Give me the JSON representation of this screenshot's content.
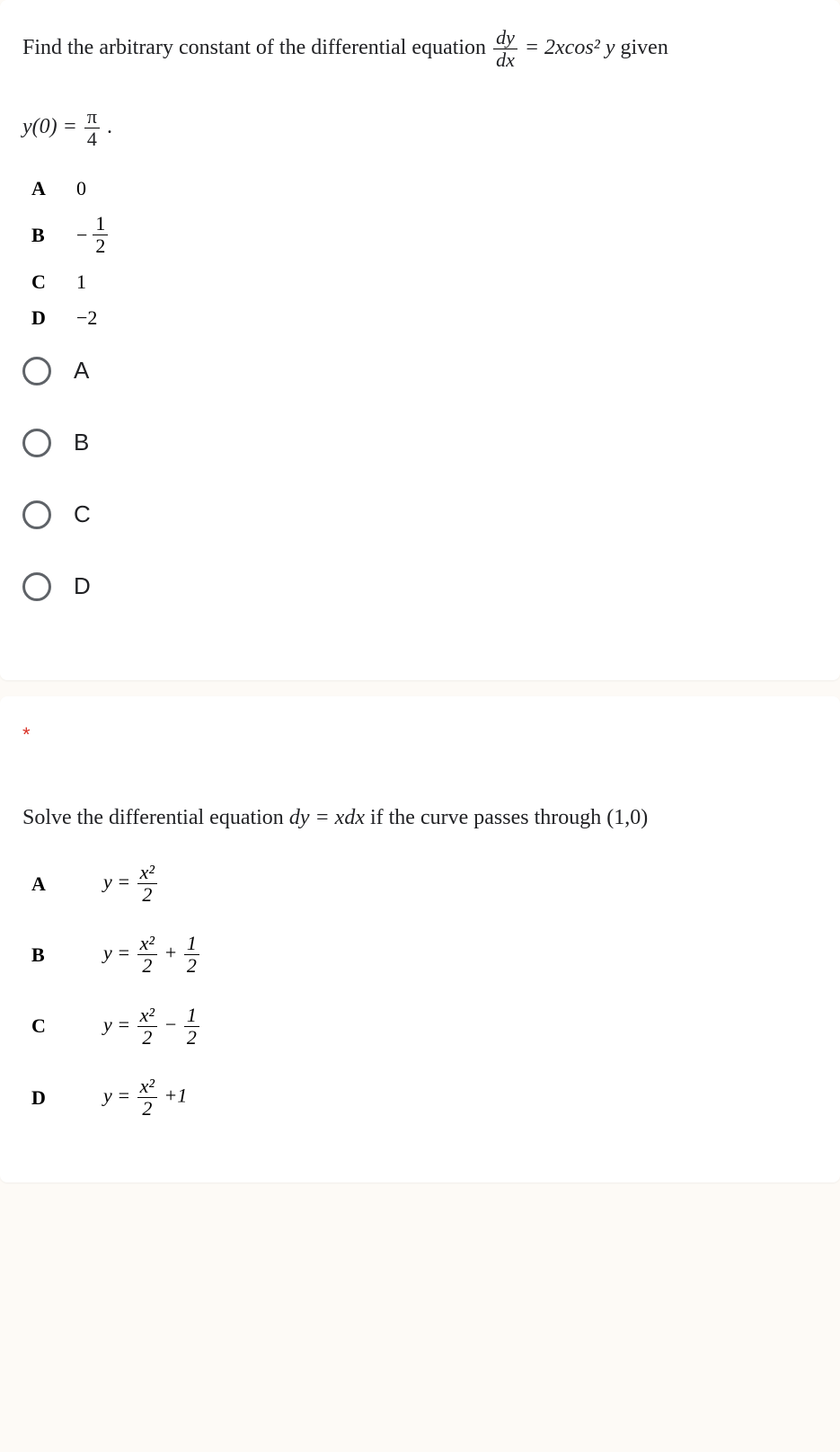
{
  "question1": {
    "prompt_part1": "Find the arbitrary constant of the differential equation ",
    "prompt_part2": " given",
    "equation_lhs_num": "dy",
    "equation_lhs_den": "dx",
    "equation_rhs": "= 2xcos² y",
    "initial_cond_left": "y(0) = ",
    "initial_cond_num": "π",
    "initial_cond_den": "4",
    "initial_cond_dot": ".",
    "answerKey": {
      "A": {
        "letter": "A",
        "text": "0"
      },
      "B": {
        "letter": "B",
        "num": "1",
        "den": "2",
        "neg": "−"
      },
      "C": {
        "letter": "C",
        "text": "1"
      },
      "D": {
        "letter": "D",
        "text": "−2"
      }
    },
    "options": {
      "A": "A",
      "B": "B",
      "C": "C",
      "D": "D"
    }
  },
  "question2": {
    "required": "*",
    "prompt_part1": "Solve the differential equation ",
    "equation": "dy = xdx",
    "prompt_part2": " if the curve passes through ",
    "point": "(1,0)",
    "answerKey": {
      "A": {
        "letter": "A",
        "lhs": "y = ",
        "num": "x²",
        "den": "2"
      },
      "B": {
        "letter": "B",
        "lhs": "y = ",
        "num1": "x²",
        "den1": "2",
        "op": " + ",
        "num2": "1",
        "den2": "2"
      },
      "C": {
        "letter": "C",
        "lhs": "y = ",
        "num1": "x²",
        "den1": "2",
        "op": " − ",
        "num2": "1",
        "den2": "2"
      },
      "D": {
        "letter": "D",
        "lhs": "y = ",
        "num": "x²",
        "den": "2",
        "suffix": " +1"
      }
    }
  }
}
